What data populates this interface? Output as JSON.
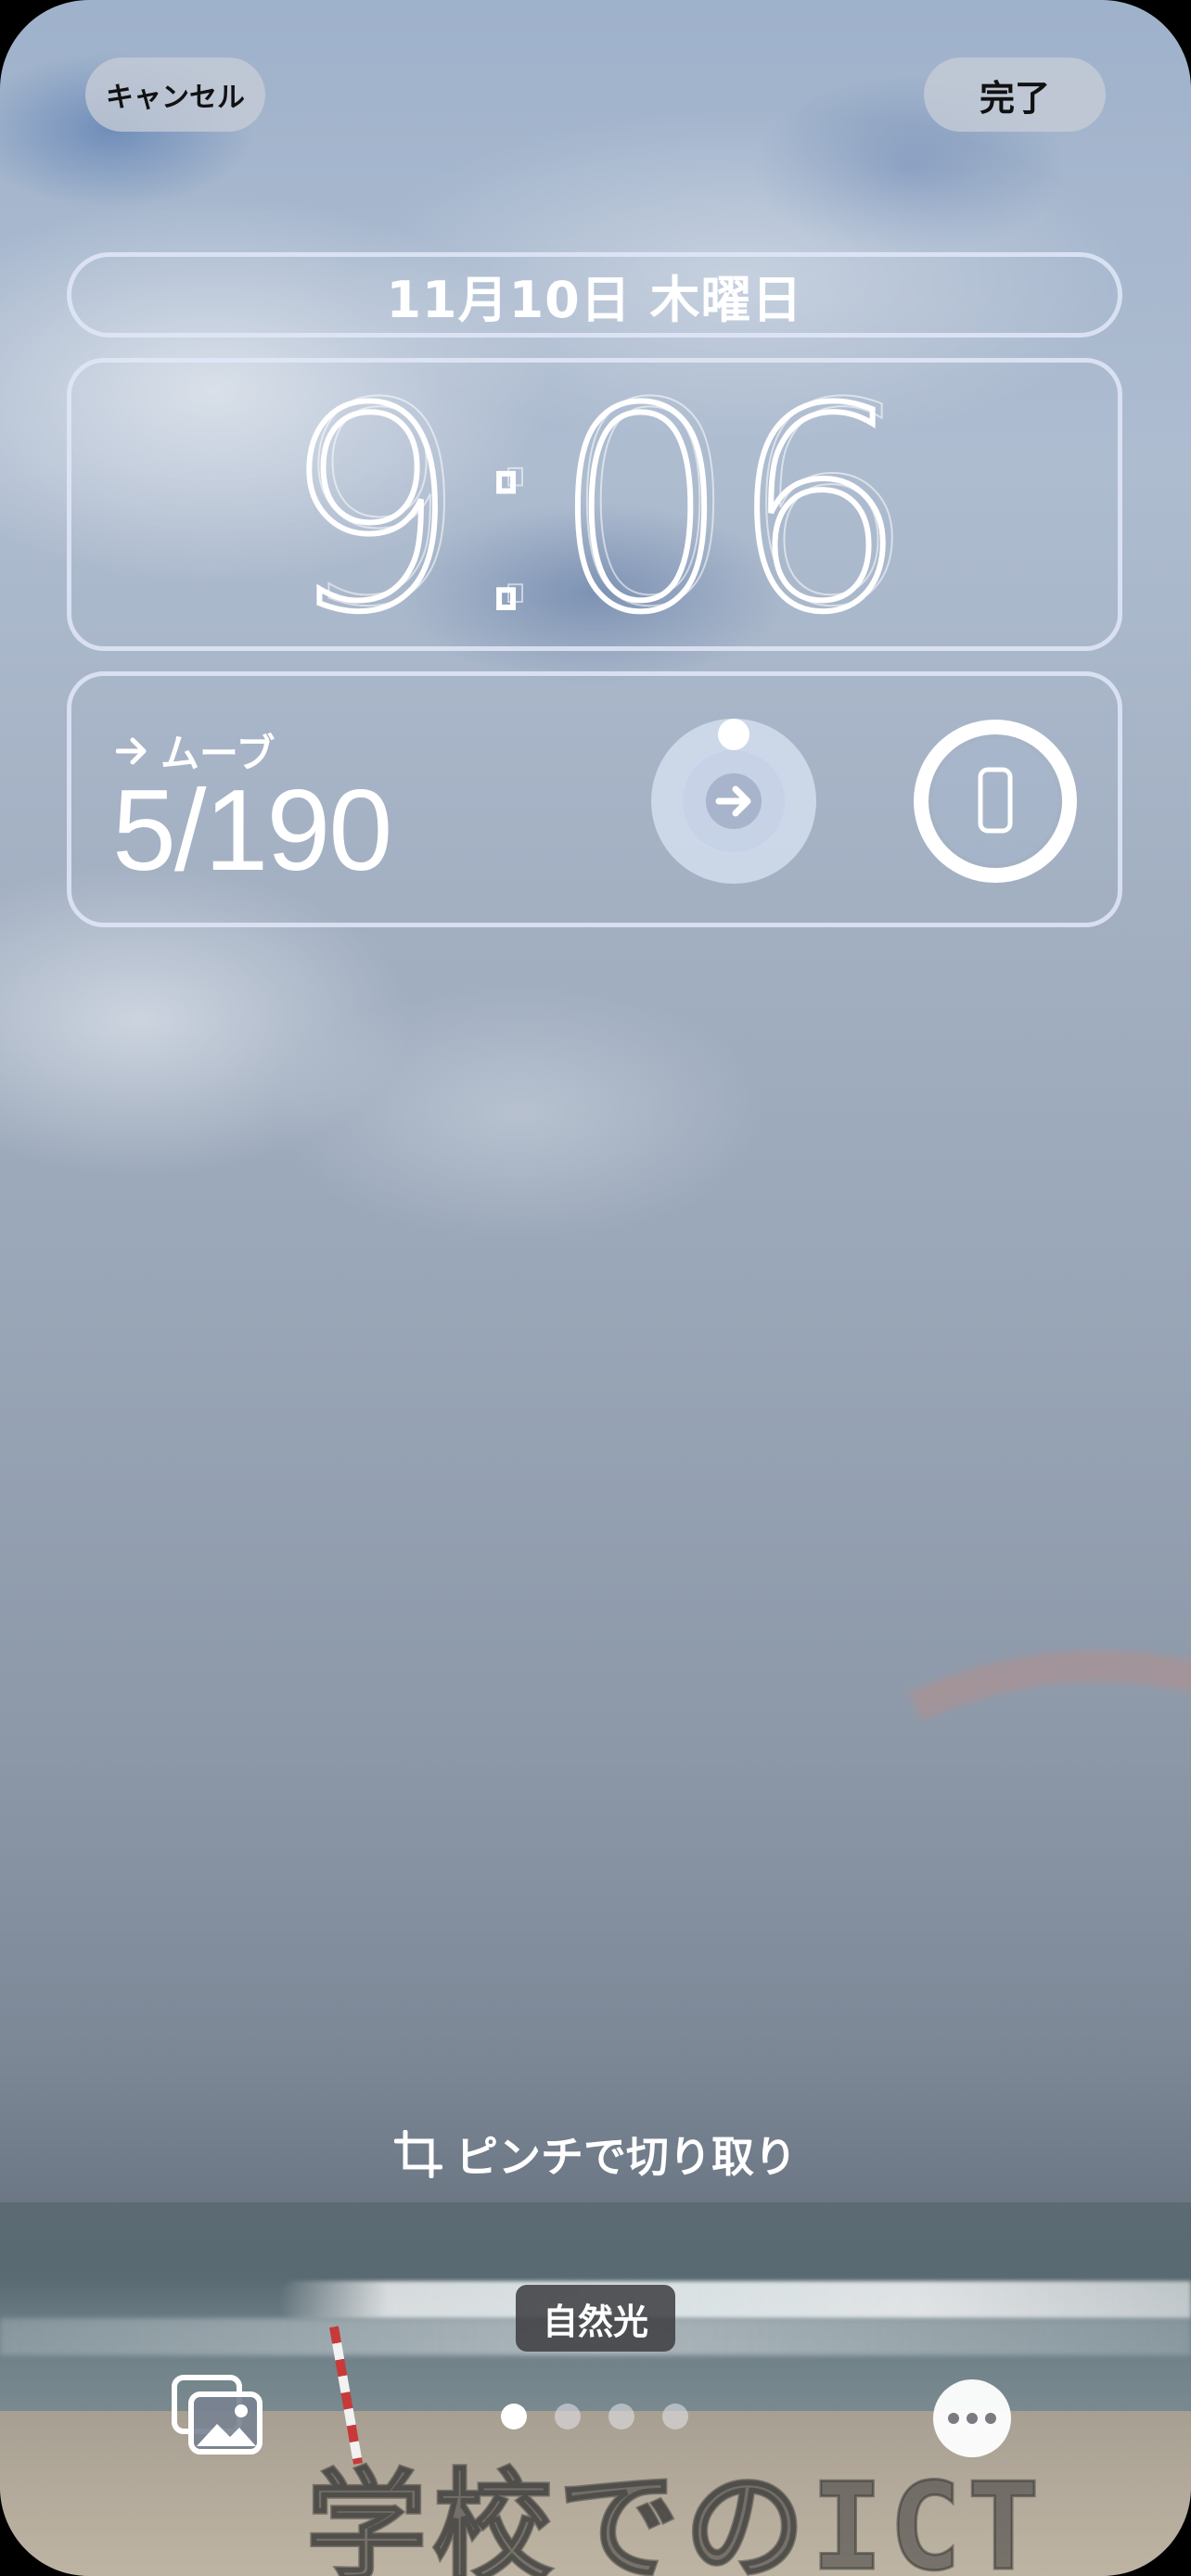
{
  "top_bar": {
    "cancel_label": "キャンセル",
    "done_label": "完了"
  },
  "lock_screen": {
    "date": "11月10日 木曜日",
    "time": "9:06",
    "move_widget": {
      "label": "ムーブ",
      "value": "5/190",
      "icon": "arrow-right-icon"
    },
    "activity_ring": {
      "icon": "arrow-right-icon",
      "progress": 0.03
    },
    "battery_ring": {
      "icon": "iphone-icon",
      "progress": 1.0
    }
  },
  "hint": {
    "icon": "crop-icon",
    "text": "ピンチで切り取り"
  },
  "filter": {
    "label": "自然光"
  },
  "bottom_bar": {
    "photos_icon": "photo-library-icon",
    "page_dots": 4,
    "active_dot": 0,
    "more_icon": "ellipsis-icon"
  },
  "watermark": "学校でのICT",
  "colors": {
    "frame": "#e1e8f8",
    "done_bg": "#c8cdd7",
    "filter_bg": "#3c3c40"
  }
}
